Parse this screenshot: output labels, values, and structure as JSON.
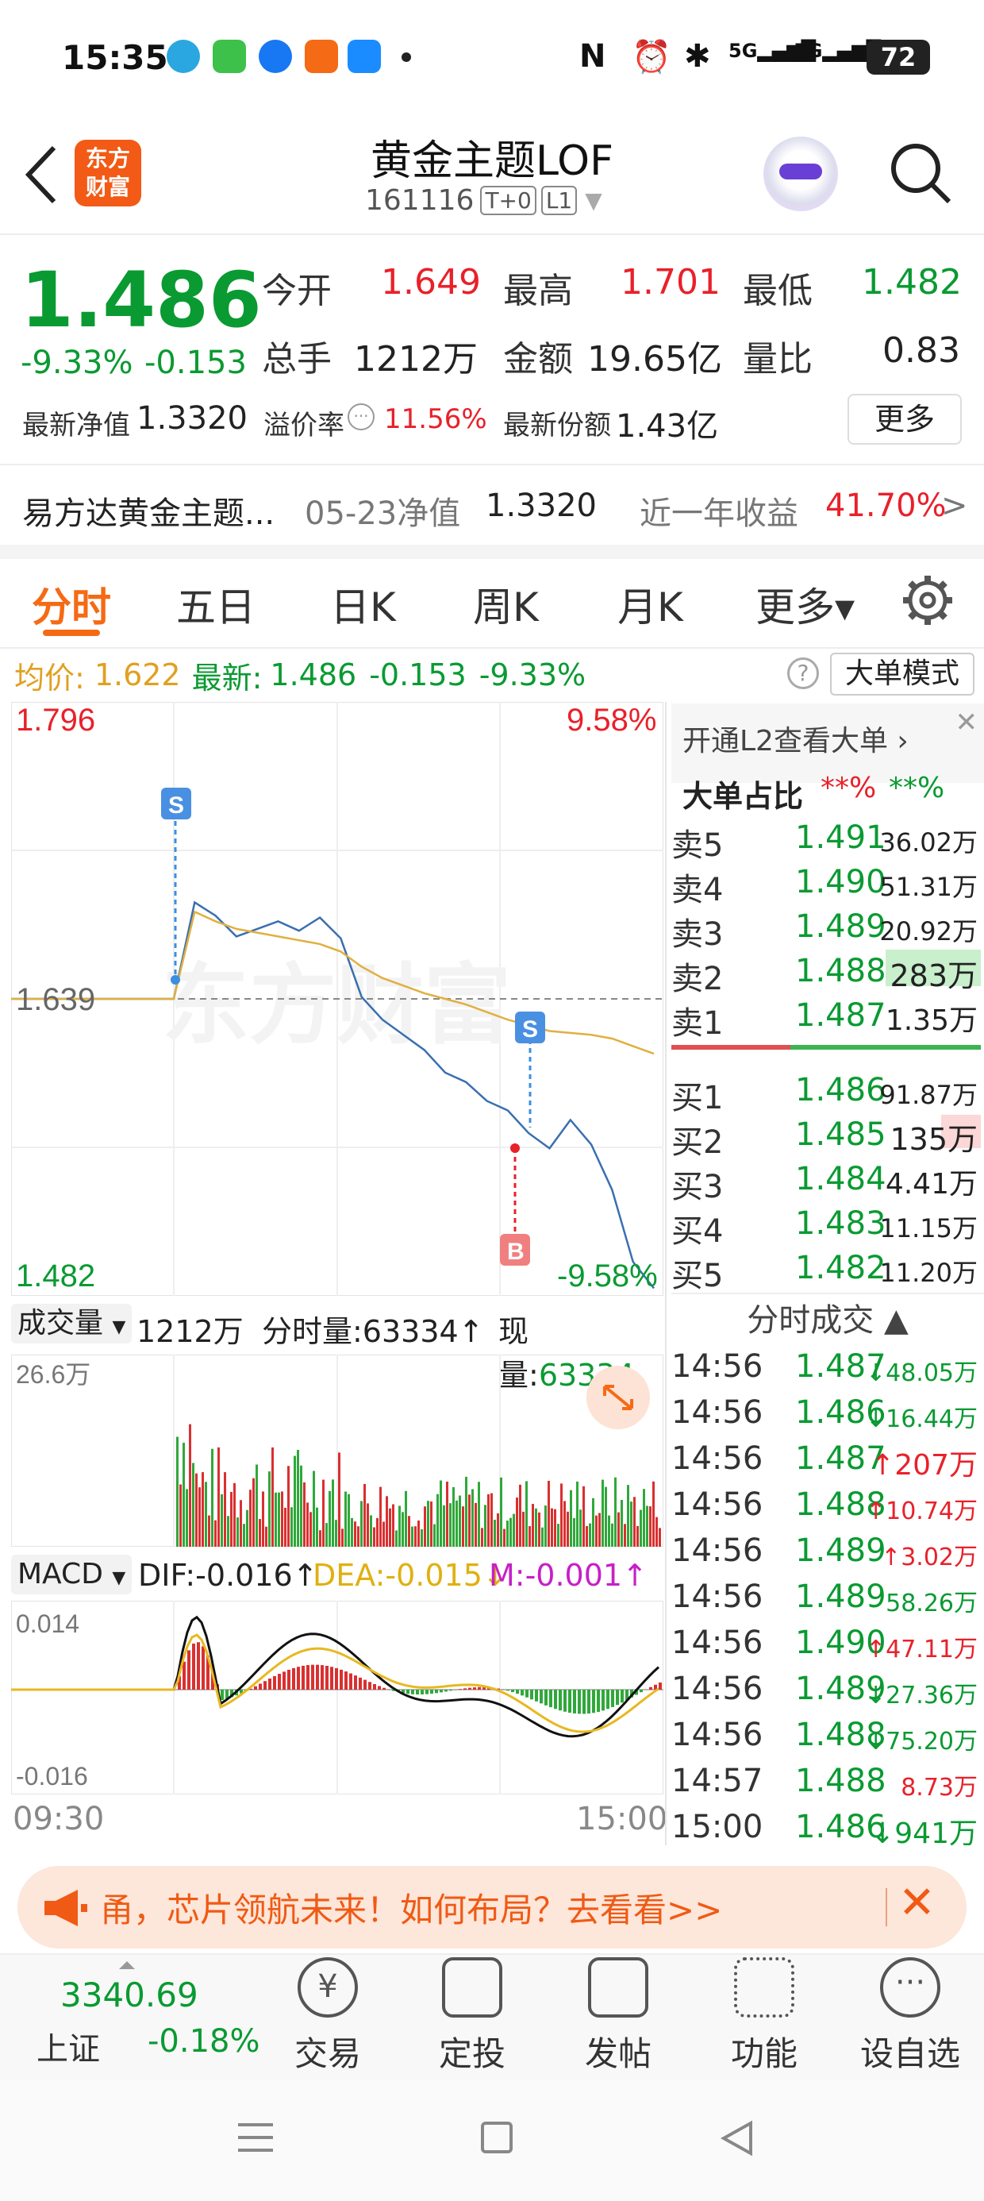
{
  "status_bar": {
    "time": "15:35",
    "battery": "72",
    "network1": "5G",
    "network2": "5G"
  },
  "header": {
    "title": "黄金主题LOF",
    "code": "161116",
    "badge1": "T+0",
    "badge2": "L1",
    "logo_text_line1": "东方",
    "logo_text_line2": "财富"
  },
  "quote": {
    "price": "1.486",
    "change_pct": "-9.33%",
    "change": "-0.153",
    "open_label": "今开",
    "open": "1.649",
    "high_label": "最高",
    "high": "1.701",
    "low_label": "最低",
    "low": "1.482",
    "volume_label": "总手",
    "volume": "1212万",
    "amount_label": "金额",
    "amount": "19.65亿",
    "ratio_label": "量比",
    "ratio": "0.83",
    "nav_label": "最新净值",
    "nav": "1.3320",
    "premium_label": "溢价率",
    "premium": "11.56%",
    "shares_label": "最新份额",
    "shares": "1.43亿",
    "more_button": "更多"
  },
  "fund_info": {
    "name": "易方达黄金主题...",
    "nav_date_label": "05-23净值",
    "nav_value": "1.3320",
    "return_label": "近一年收益",
    "return_value": "41.70%",
    "arrow": ">"
  },
  "tabs": [
    {
      "label": "分时",
      "active": true
    },
    {
      "label": "五日"
    },
    {
      "label": "日K"
    },
    {
      "label": "周K"
    },
    {
      "label": "月K"
    },
    {
      "label": "更多▾"
    }
  ],
  "chart_header": {
    "avg_label": "均价:",
    "avg_value": "1.622",
    "latest_label": "最新:",
    "latest_value": "1.486",
    "latest_change": "-0.153",
    "latest_pct": "-9.33%",
    "mode_button": "大单模式",
    "help_icon": "?"
  },
  "chart_labels": {
    "y_top": "1.796",
    "y_mid": "1.639",
    "y_bottom": "1.482",
    "pct_top": "9.58%",
    "pct_bottom": "-9.58%",
    "marker_s": "S",
    "marker_b": "B",
    "watermark": "东方财富"
  },
  "chart_data": [
    {
      "type": "line",
      "xlabel": "",
      "ylabel": "",
      "ylim": [
        1.482,
        1.796
      ],
      "x_ticks": [
        "09:30",
        "15:00"
      ],
      "series": [
        {
          "values": [
            1.639,
            1.69,
            1.683,
            1.672,
            1.676,
            1.68,
            1.675,
            1.682,
            1.671,
            1.64,
            1.628,
            1.62,
            1.612,
            1.6,
            1.595,
            1.585,
            1.58,
            1.568,
            1.56,
            1.575,
            1.562,
            1.538,
            1.5,
            1.486
          ]
        },
        {
          "values": [
            1.639,
            1.685,
            1.68,
            1.676,
            1.674,
            1.672,
            1.67,
            1.668,
            1.664,
            1.656,
            1.65,
            1.646,
            1.642,
            1.639,
            1.636,
            1.632,
            1.628,
            1.625,
            1.622,
            1.621,
            1.62,
            1.618,
            1.614,
            1.61
          ]
        }
      ]
    }
  ],
  "volume_panel": {
    "selector": "成交量",
    "total": "1212万",
    "fs_label": "分时量:63334↑",
    "now_label": "现量:",
    "now_value": "63334",
    "y_max": "26.6万"
  },
  "macd_panel": {
    "selector": "MACD",
    "dif": "DIF:-0.016↑",
    "dea": "DEA:-0.015↓",
    "m": "M:-0.001↑",
    "y_top": "0.014",
    "y_bottom": "-0.016",
    "x_start": "09:30",
    "x_end": "15:00"
  },
  "orderbook": {
    "promo": "开通L2查看大单 ›",
    "ratio_label": "大单占比",
    "ratio_red": "**%",
    "ratio_green": "**%",
    "sell": [
      {
        "name": "卖5",
        "price": "1.491",
        "vol": "36.02万"
      },
      {
        "name": "卖4",
        "price": "1.490",
        "vol": "51.31万"
      },
      {
        "name": "卖3",
        "price": "1.489",
        "vol": "20.92万"
      },
      {
        "name": "卖2",
        "price": "1.488",
        "vol": "283万"
      },
      {
        "name": "卖1",
        "price": "1.487",
        "vol": "1.35万"
      }
    ],
    "buy": [
      {
        "name": "买1",
        "price": "1.486",
        "vol": "91.87万"
      },
      {
        "name": "买2",
        "price": "1.485",
        "vol": "135万"
      },
      {
        "name": "买3",
        "price": "1.484",
        "vol": "4.41万"
      },
      {
        "name": "买4",
        "price": "1.483",
        "vol": "11.15万"
      },
      {
        "name": "买5",
        "price": "1.482",
        "vol": "11.20万"
      }
    ]
  },
  "ticks": {
    "title": "分时成交 ▲",
    "rows": [
      {
        "time": "14:56",
        "price": "1.487",
        "vol": "↓48.05万"
      },
      {
        "time": "14:56",
        "price": "1.486",
        "vol": "↓16.44万"
      },
      {
        "time": "14:56",
        "price": "1.487",
        "vol": "↑207万"
      },
      {
        "time": "14:56",
        "price": "1.488",
        "vol": "↑10.74万"
      },
      {
        "time": "14:56",
        "price": "1.489",
        "vol": "↑3.02万"
      },
      {
        "time": "14:56",
        "price": "1.489",
        "vol": "58.26万"
      },
      {
        "time": "14:56",
        "price": "1.490",
        "vol": "↑47.11万"
      },
      {
        "time": "14:56",
        "price": "1.489",
        "vol": "↓27.36万"
      },
      {
        "time": "14:56",
        "price": "1.488",
        "vol": "↓75.20万"
      },
      {
        "time": "14:57",
        "price": "1.488",
        "vol": "8.73万"
      },
      {
        "time": "15:00",
        "price": "1.486",
        "vol": "↓941万"
      }
    ]
  },
  "banner": {
    "text": "甬，芯片领航未来！如何布局？去看看>>"
  },
  "bottom_nav": {
    "index_value": "3340.69",
    "index_name": "上证",
    "index_change": "-0.18%",
    "items": [
      {
        "label": "交易"
      },
      {
        "label": "定投"
      },
      {
        "label": "发帖"
      },
      {
        "label": "功能"
      },
      {
        "label": "设自选"
      }
    ]
  },
  "colors": {
    "up": "#e8212a",
    "down": "#0a9a32",
    "accent": "#f56a14",
    "avg_line": "#e0b040"
  }
}
